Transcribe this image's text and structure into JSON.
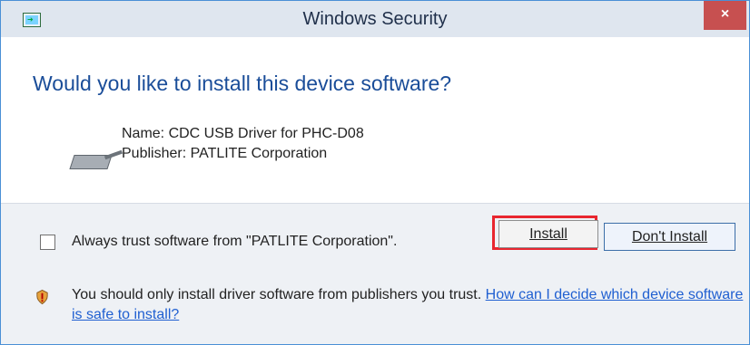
{
  "window": {
    "title": "Windows Security",
    "close_label": "×"
  },
  "dialog": {
    "heading": "Would you like to install this device software?",
    "name_line": "Name: CDC USB Driver for PHC-D08",
    "publisher_line": "Publisher: PATLITE Corporation"
  },
  "options": {
    "always_trust_label": "Always trust software from \"PATLITE Corporation\".",
    "install_label": "Install",
    "dont_install_label": "Don't Install"
  },
  "warning": {
    "text": "You should only install driver software from publishers you trust.",
    "link_text": "How can I decide which device software is safe to install?"
  },
  "colors": {
    "accent": "#1a4d99",
    "close_bg": "#c75050",
    "highlight": "#e8262f",
    "link": "#1f5fd1"
  },
  "icons": {
    "app": "device-install-icon",
    "device": "usb-device-icon",
    "shield": "shield-warning-icon",
    "close": "close-icon"
  }
}
